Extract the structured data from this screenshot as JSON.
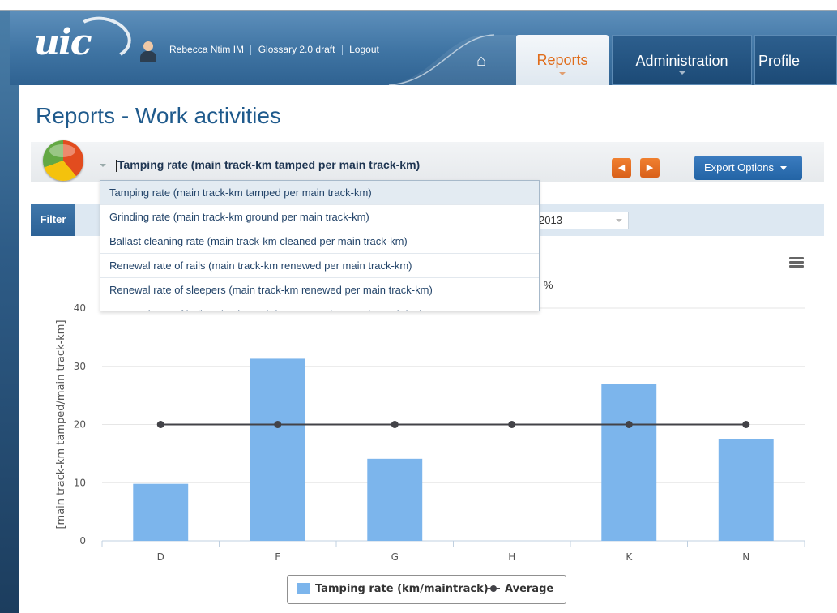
{
  "header": {
    "user_name": "Rebecca Ntim IM",
    "glossary_link": "Glossary 2.0 draft",
    "logout_link": "Logout",
    "logo": "uic"
  },
  "nav": {
    "home_icon": "home-icon",
    "tabs": [
      {
        "label": "Reports",
        "active": true
      },
      {
        "label": "Administration",
        "active": false
      },
      {
        "label": "Profile",
        "active": false
      }
    ]
  },
  "page": {
    "title": "Reports - Work activities"
  },
  "toolbar": {
    "selected_report": "Tamping rate (main track-km tamped per main track-km)",
    "prev_icon": "chevron-left-icon",
    "next_icon": "chevron-right-icon",
    "export_label": "Export Options"
  },
  "filter": {
    "label": "Filter",
    "year_value": "2013"
  },
  "dropdown": {
    "items": [
      "Tamping rate (main track-km tamped per main track-km)",
      "Grinding rate (main track-km ground per main track-km)",
      "Ballast cleaning rate (main track-km cleaned per main track-km)",
      "Renewal rate of rails (main track-km renewed per main track-km)",
      "Renewal rate of sleepers (main track-km renewed per main track-km)",
      "Renewal rate of ballast (main track-km renewed per main track-km)"
    ]
  },
  "chart_subtitle_fragment": "n %",
  "colors": {
    "bar": "#7cb5ec",
    "average": "#434348",
    "accent_orange": "#e06c1a",
    "title_blue": "#1f5a8c"
  },
  "chart_data": {
    "type": "bar",
    "categories": [
      "D",
      "F",
      "G",
      "H",
      "K",
      "N"
    ],
    "series": [
      {
        "name": "Tamping rate (km/maintrack)",
        "type": "bar",
        "values": [
          9.8,
          31.3,
          14.1,
          0,
          27,
          17.5
        ]
      },
      {
        "name": "Average",
        "type": "line",
        "values": [
          20,
          20,
          20,
          20,
          20,
          20
        ]
      }
    ],
    "ylabel": "[main track-km tamped/main track-km]",
    "ylim": [
      0,
      40
    ],
    "yticks": [
      0,
      10,
      20,
      30,
      40
    ],
    "grid": true,
    "legend_position": "bottom-center"
  }
}
